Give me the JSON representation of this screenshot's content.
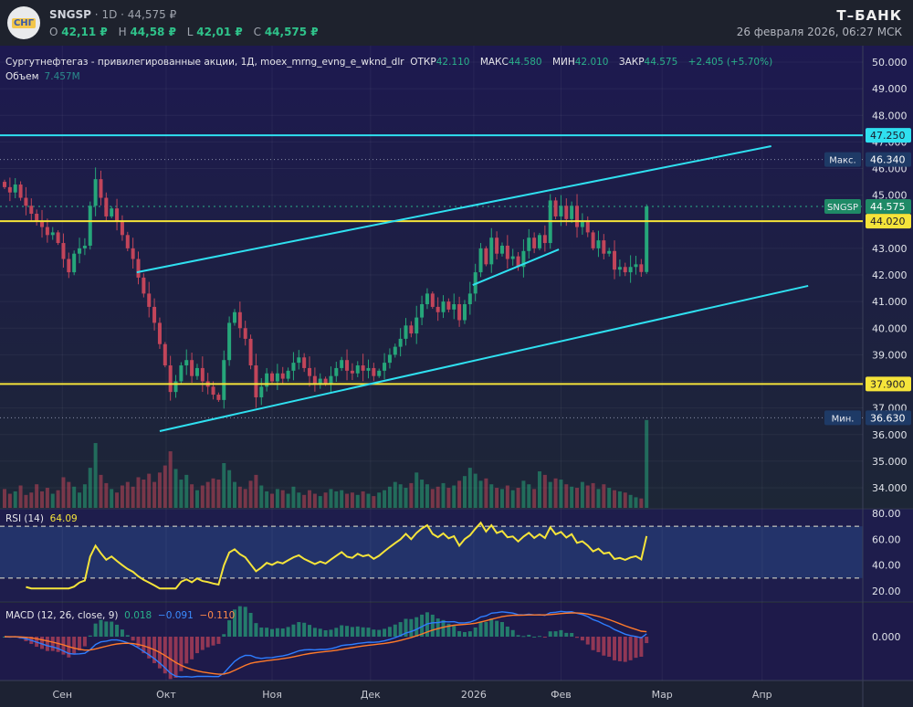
{
  "header": {
    "ticker": "SNGSP",
    "interval": "1D",
    "price": "44,575 ₽",
    "logo_text": "СНГ",
    "ohlc": [
      {
        "label": "O",
        "value": "42,11 ₽"
      },
      {
        "label": "H",
        "value": "44,58 ₽"
      },
      {
        "label": "L",
        "value": "42,01 ₽"
      },
      {
        "label": "C",
        "value": "44,575 ₽"
      }
    ],
    "brand": "Т–БАНК",
    "datetime": "26 февраля 2026, 06:27 МСК"
  },
  "legend": {
    "title": "Сургутнефтегаз - привилегированные акции, 1Д, moex_mrng_evng_e_wknd_dlr",
    "open_label": "ОТКР",
    "open": "42.110",
    "high_label": "МАКС",
    "high": "44.580",
    "low_label": "МИН",
    "low": "42.010",
    "close_label": "ЗАКР",
    "close": "44.575",
    "change": "+2.405 (+5.70%)",
    "volume_label": "Объем",
    "volume": "7.457M"
  },
  "rsi": {
    "label": "RSI (14)",
    "value": "64.09"
  },
  "macd": {
    "label": "MACD (12, 26, close, 9)",
    "hist": "0.018",
    "macd": "−0.091",
    "signal": "−0.110"
  },
  "colors": {
    "up": "#26a67a",
    "down": "#c2455a",
    "cyan": "#2fe0f0",
    "yellow": "#f5e43a",
    "rsi": "#f5e43a",
    "macd": "#2e7dff",
    "signal": "#ff7a2a"
  },
  "chart_data": {
    "type": "candlestick",
    "title": "SNGSP 1D",
    "ylim": [
      33.5,
      50.3
    ],
    "price_ticks": [
      "50.000",
      "49.000",
      "48.000",
      "47.000",
      "46.000",
      "45.000",
      "44.000",
      "43.000",
      "42.000",
      "41.000",
      "40.000",
      "39.000",
      "38.000",
      "37.000",
      "36.000",
      "35.000",
      "34.000"
    ],
    "rsi_ticks": [
      "80.00",
      "60.00",
      "40.00",
      "20.00"
    ],
    "macd_ticks": [
      "0.000"
    ],
    "x_ticks": [
      {
        "label": "Сен",
        "index": 10.8
      },
      {
        "label": "Окт",
        "index": 30.2
      },
      {
        "label": "Ноя",
        "index": 50
      },
      {
        "label": "Дек",
        "index": 68.4
      },
      {
        "label": "2026",
        "index": 87.7
      },
      {
        "label": "Фев",
        "index": 104
      },
      {
        "label": "Мар",
        "index": 122.9
      },
      {
        "label": "Апр",
        "index": 141.6
      }
    ],
    "first_open": 45.5,
    "close": [
      45.3,
      45.1,
      45.4,
      44.9,
      44.6,
      44.3,
      44.0,
      43.8,
      43.5,
      43.6,
      43.2,
      42.6,
      42.1,
      42.8,
      43.0,
      43.1,
      44.6,
      45.6,
      44.9,
      44.2,
      44.5,
      44.0,
      43.5,
      43.0,
      42.6,
      41.9,
      41.3,
      40.8,
      40.2,
      39.4,
      38.6,
      37.6,
      38.0,
      38.6,
      38.8,
      38.2,
      38.5,
      38.0,
      37.8,
      37.5,
      37.3,
      38.8,
      40.2,
      40.6,
      40.0,
      39.6,
      38.6,
      37.4,
      37.8,
      38.3,
      38.0,
      38.3,
      38.1,
      38.4,
      38.7,
      38.9,
      38.5,
      38.2,
      37.9,
      38.1,
      37.9,
      38.2,
      38.5,
      38.8,
      38.4,
      38.3,
      38.6,
      38.4,
      38.5,
      38.2,
      38.4,
      38.7,
      39.0,
      39.3,
      39.6,
      40.1,
      39.8,
      40.4,
      40.9,
      41.3,
      40.8,
      40.6,
      41.0,
      40.7,
      40.9,
      40.3,
      40.9,
      41.3,
      42.1,
      43.0,
      42.4,
      43.4,
      42.8,
      43.1,
      42.6,
      42.7,
      42.3,
      42.9,
      43.4,
      43.0,
      43.5,
      43.2,
      44.8,
      44.2,
      44.6,
      44.1,
      44.6,
      43.8,
      44.0,
      43.6,
      43.0,
      43.3,
      42.8,
      42.9,
      42.2,
      42.3,
      42.1,
      42.3,
      42.4,
      42.11,
      44.575
    ],
    "volume_millions": [
      1.6,
      1.2,
      1.4,
      1.9,
      1.1,
      1.3,
      2.0,
      1.4,
      1.7,
      1.2,
      1.5,
      2.6,
      2.2,
      1.8,
      1.3,
      2.0,
      3.4,
      5.5,
      2.8,
      2.1,
      1.6,
      1.3,
      1.9,
      2.2,
      1.8,
      2.6,
      2.4,
      2.9,
      2.2,
      3.0,
      3.6,
      4.8,
      3.3,
      2.4,
      2.8,
      2.0,
      1.5,
      1.9,
      2.2,
      2.5,
      2.4,
      3.8,
      3.2,
      2.2,
      1.8,
      1.6,
      2.3,
      2.8,
      1.9,
      1.4,
      1.2,
      1.6,
      1.5,
      1.2,
      1.8,
      1.3,
      1.1,
      1.5,
      1.2,
      1.0,
      1.3,
      1.6,
      1.4,
      1.5,
      1.2,
      1.3,
      1.1,
      1.4,
      1.2,
      1.0,
      1.3,
      1.5,
      1.8,
      2.2,
      2.0,
      1.7,
      2.1,
      3.0,
      2.4,
      2.0,
      1.6,
      1.8,
      2.1,
      1.7,
      1.9,
      2.3,
      2.7,
      3.4,
      2.9,
      2.3,
      2.5,
      2.0,
      1.7,
      1.6,
      1.9,
      1.5,
      1.7,
      2.3,
      2.0,
      1.6,
      3.1,
      2.8,
      2.2,
      2.5,
      2.4,
      2.0,
      1.8,
      1.7,
      2.2,
      1.9,
      2.1,
      1.6,
      2.0,
      1.7,
      1.5,
      1.4,
      1.3,
      1.1,
      0.9,
      0.8,
      7.457
    ],
    "levels": [
      {
        "price": 47.25,
        "label": "47.250",
        "color": "cyan"
      },
      {
        "price": 44.02,
        "label": "44.020",
        "color": "yellow"
      },
      {
        "price": 37.9,
        "label": "37.900",
        "color": "yellow"
      }
    ],
    "max_marker": {
      "label": "Макс.",
      "price": 46.34,
      "value": "46.340"
    },
    "min_marker": {
      "label": "Мин.",
      "price": 36.63,
      "value": "36.630"
    },
    "last_marker": {
      "label": "SNGSP",
      "price": 44.575,
      "value": "44.575"
    },
    "trendlines": [
      {
        "from": [
          24.7,
          42.1
        ],
        "to": [
          143.3,
          46.84
        ]
      },
      {
        "from": [
          29.0,
          36.13
        ],
        "to": [
          150.2,
          41.59
        ]
      },
      {
        "from": [
          87.5,
          41.62
        ],
        "to": [
          103.6,
          42.96
        ]
      }
    ],
    "rsi_levels": [
      70,
      30
    ]
  }
}
